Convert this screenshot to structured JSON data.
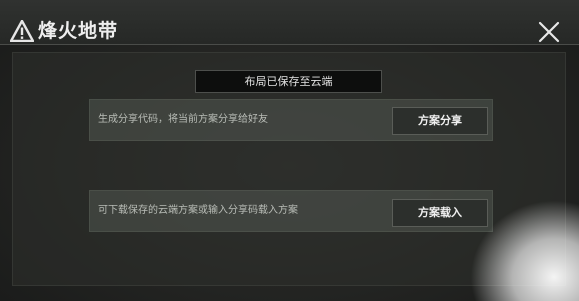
{
  "window": {
    "title": "烽火地带",
    "title_icon": "warning-triangle-icon",
    "close_icon": "close-icon"
  },
  "status": {
    "message": "布局已保存至云端"
  },
  "share_row": {
    "description": "生成分享代码，将当前方案分享给好友",
    "button_label": "方案分享"
  },
  "import_row": {
    "description": "可下载保存的云端方案或输入分享码载入方案",
    "button_label": "方案载入"
  },
  "colors": {
    "background": "#232422",
    "row_background": "#4a5049",
    "button_background": "#2c2f2c",
    "text_primary": "#eeeeee",
    "text_secondary": "#b9bdb7"
  }
}
